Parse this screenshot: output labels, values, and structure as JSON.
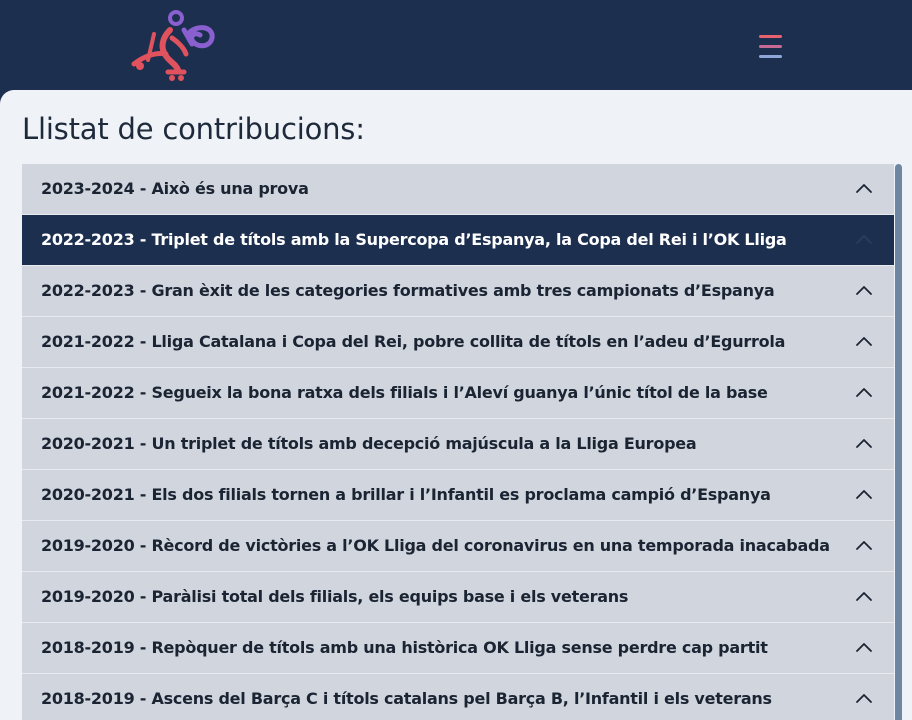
{
  "colors": {
    "header_bg": "#1d2f4f",
    "panel_bg": "#eff3f7",
    "item_bg": "#d1d6de",
    "item_active_bg": "#1d2f4f",
    "logo_red": "#e0525d",
    "logo_purple": "#8a5fd0"
  },
  "header": {
    "logo_icon": "roller-hockey-player-logo",
    "menu_icon": "hamburger-menu-icon"
  },
  "main": {
    "title": "Llistat de contribucions:",
    "active_index": 1,
    "items": [
      {
        "label": "2023-2024 - Això és una prova"
      },
      {
        "label": "2022-2023 - Triplet de títols amb la Supercopa d’Espanya, la Copa del Rei i l’OK Lliga"
      },
      {
        "label": "2022-2023 - Gran èxit de les categories formatives amb tres campionats d’Espanya"
      },
      {
        "label": "2021-2022 - Lliga Catalana i Copa del Rei, pobre collita de títols en l’adeu d’Egurrola"
      },
      {
        "label": "2021-2022 - Segueix la bona ratxa dels filials i l’Aleví guanya l’únic títol de la base"
      },
      {
        "label": "2020-2021 - Un triplet de títols amb decepció majúscula a la Lliga Europea"
      },
      {
        "label": "2020-2021 - Els dos filials tornen a brillar i l’Infantil es proclama campió d’Espanya"
      },
      {
        "label": "2019-2020 - Rècord de victòries a l’OK Lliga del coronavirus en una temporada inacabada"
      },
      {
        "label": "2019-2020 - Paràlisi total dels filials, els equips base i els veterans"
      },
      {
        "label": "2018-2019 - Repòquer de títols amb una històrica OK Lliga sense perdre cap partit"
      },
      {
        "label": "2018-2019 - Ascens del Barça C i títols catalans pel Barça B, l’Infantil i els veterans"
      }
    ]
  }
}
